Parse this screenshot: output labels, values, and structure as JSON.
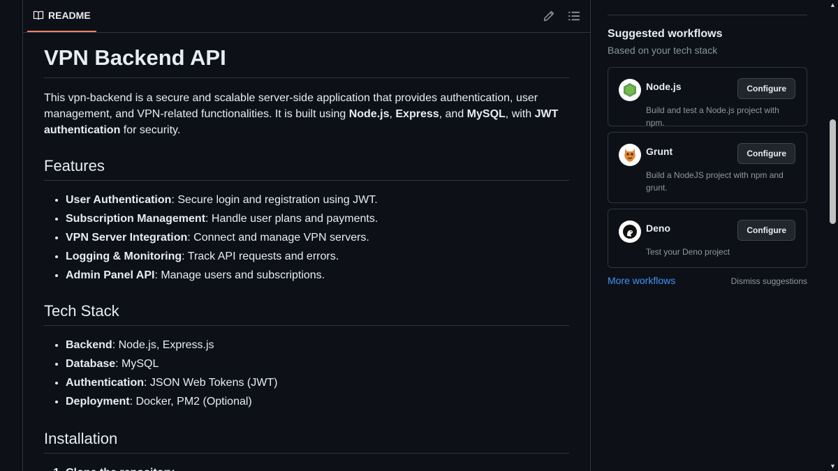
{
  "readme": {
    "tab_label": "README",
    "title": "VPN Backend API",
    "intro": {
      "t1": "This vpn-backend is a secure and scalable server-side application that provides authentication, user management, and VPN-related functionalities. It is built using ",
      "b1": "Node.js",
      "t2": ", ",
      "b2": "Express",
      "t3": ", and ",
      "b3": "MySQL",
      "t4": ", with ",
      "b4": "JWT authentication",
      "t5": " for security."
    },
    "features_heading": "Features",
    "features": [
      {
        "bold": "User Authentication",
        "text": ": Secure login and registration using JWT."
      },
      {
        "bold": "Subscription Management",
        "text": ": Handle user plans and payments."
      },
      {
        "bold": "VPN Server Integration",
        "text": ": Connect and manage VPN servers."
      },
      {
        "bold": "Logging & Monitoring",
        "text": ": Track API requests and errors."
      },
      {
        "bold": "Admin Panel API",
        "text": ": Manage users and subscriptions."
      }
    ],
    "tech_heading": "Tech Stack",
    "tech": [
      {
        "bold": "Backend",
        "text": ": Node.js, Express.js"
      },
      {
        "bold": "Database",
        "text": ": MySQL"
      },
      {
        "bold": "Authentication",
        "text": ": JSON Web Tokens (JWT)"
      },
      {
        "bold": "Deployment",
        "text": ": Docker, PM2 (Optional)"
      }
    ],
    "install_heading": "Installation",
    "install_steps": [
      "Clone the repository"
    ]
  },
  "sidebar": {
    "title": "Suggested workflows",
    "subtitle": "Based on your tech stack",
    "workflows": [
      {
        "name": "Node.js",
        "desc": "Build and test a Node.js project with npm.",
        "button": "Configure",
        "icon": "nodejs-icon"
      },
      {
        "name": "Grunt",
        "desc": "Build a NodeJS project with npm and grunt.",
        "button": "Configure",
        "icon": "grunt-icon"
      },
      {
        "name": "Deno",
        "desc": "Test your Deno project",
        "button": "Configure",
        "icon": "deno-icon"
      }
    ],
    "more_link": "More workflows",
    "dismiss": "Dismiss suggestions"
  },
  "colors": {
    "background": "#0d1117",
    "border": "#30363d",
    "link": "#4493f8",
    "tab_accent": "#f78166"
  }
}
